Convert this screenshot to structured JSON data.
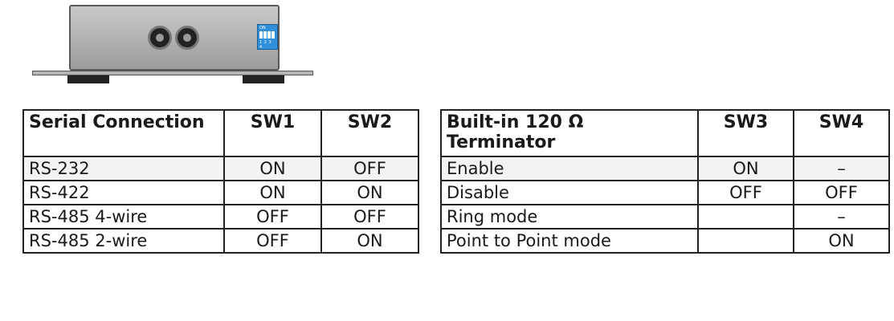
{
  "device": {
    "dip_label_on": "ON",
    "dip_label_numbers": "1 2 3 4",
    "dip_color": "#2f8fd9"
  },
  "serial_table": {
    "headers": [
      "Serial Connection",
      "SW1",
      "SW2"
    ],
    "rows": [
      {
        "mode": "RS-232",
        "sw1": "ON",
        "sw2": "OFF"
      },
      {
        "mode": "RS-422",
        "sw1": "ON",
        "sw2": "ON"
      },
      {
        "mode": "RS-485 4-wire",
        "sw1": "OFF",
        "sw2": "OFF"
      },
      {
        "mode": "RS-485 2-wire",
        "sw1": "OFF",
        "sw2": "ON"
      }
    ]
  },
  "terminator_table": {
    "headers": [
      "Built-in 120 Ω Terminator",
      "SW3",
      "SW4"
    ],
    "rows": [
      {
        "mode": "Enable",
        "sw3": "ON",
        "sw4": "–"
      },
      {
        "mode": "Disable",
        "sw3": "OFF",
        "sw4": "OFF"
      },
      {
        "mode": "Ring mode",
        "sw3": "",
        "sw4": "–"
      },
      {
        "mode": "Point to Point mode",
        "sw3": "",
        "sw4": "ON"
      }
    ]
  }
}
